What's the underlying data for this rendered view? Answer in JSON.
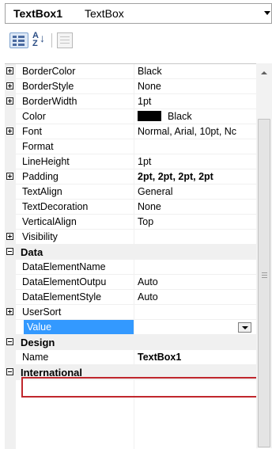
{
  "object_selector": {
    "name": "TextBox1",
    "type": "TextBox"
  },
  "toolbar": {
    "categorized_icon": "categorized-icon",
    "alphabetical_icon": "sort-alphabetical-icon",
    "alphabetical_glyph_top": "A",
    "alphabetical_glyph_bottom": "Z",
    "alphabetical_arrow": "↓",
    "property_pages_icon": "property-pages-icon"
  },
  "rows": [
    {
      "name": "BorderColor",
      "value": "Black"
    },
    {
      "name": "BorderStyle",
      "value": "None"
    },
    {
      "name": "BorderWidth",
      "value": "1pt"
    },
    {
      "name": "Color",
      "value": "Black"
    },
    {
      "name": "Font",
      "value": "Normal, Arial, 10pt, Nc"
    },
    {
      "name": "Format",
      "value": ""
    },
    {
      "name": "LineHeight",
      "value": "1pt"
    },
    {
      "name": "Padding",
      "value": "2pt, 2pt, 2pt, 2pt"
    },
    {
      "name": "TextAlign",
      "value": "General"
    },
    {
      "name": "TextDecoration",
      "value": "None"
    },
    {
      "name": "VerticalAlign",
      "value": "Top"
    },
    {
      "name": "Visibility",
      "value": ""
    },
    {
      "name": "Data",
      "value": ""
    },
    {
      "name": "DataElementName",
      "value": ""
    },
    {
      "name": "DataElementOutpu",
      "value": "Auto"
    },
    {
      "name": "DataElementStyle",
      "value": "Auto"
    },
    {
      "name": "UserSort",
      "value": ""
    },
    {
      "name": "Value",
      "value": ""
    },
    {
      "name": "Design",
      "value": ""
    },
    {
      "name": "Name",
      "value": "TextBox1"
    },
    {
      "name": "International",
      "value": ""
    }
  ],
  "colors": {
    "selection": "#3399ff",
    "highlight_box": "#c0272d",
    "color_swatch": "#000000"
  }
}
